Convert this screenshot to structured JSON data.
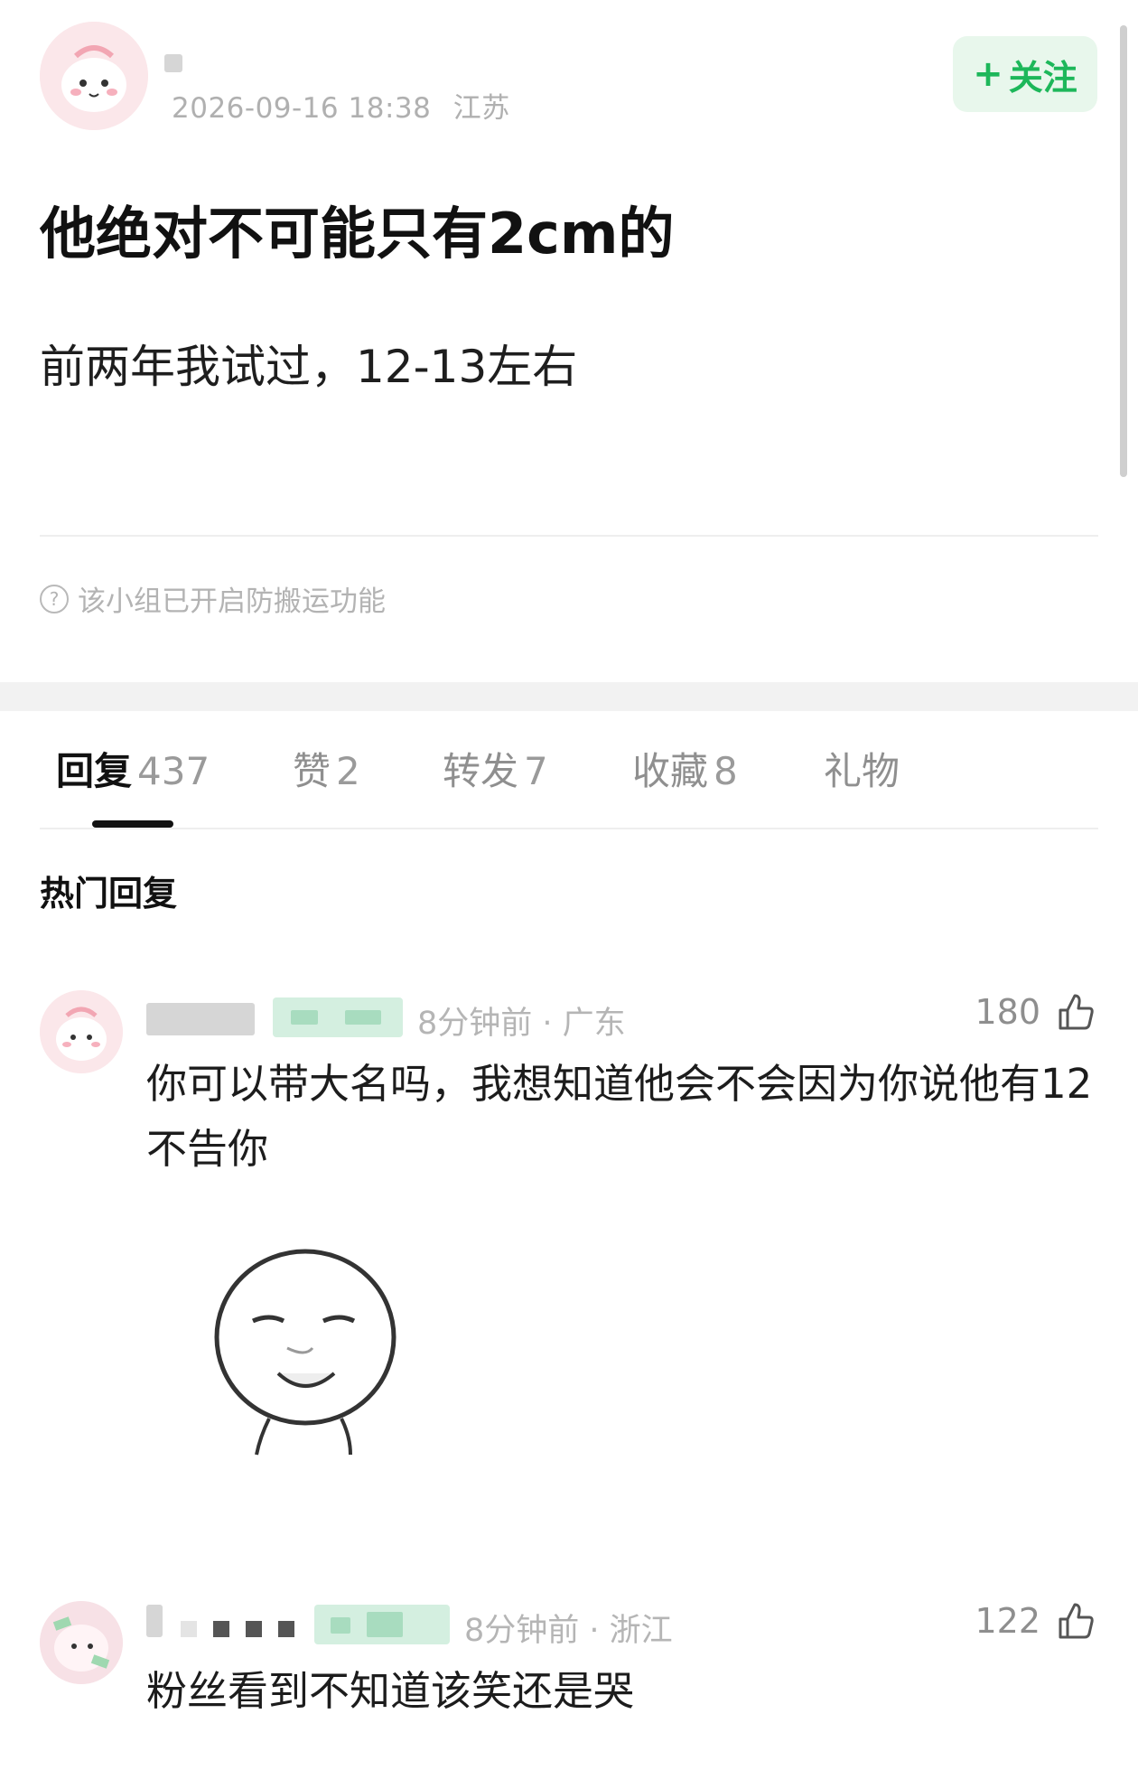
{
  "post": {
    "timestamp": "2026-09-16 18:38",
    "location": "江苏",
    "follow_label": "关注",
    "title": "他绝对不可能只有2cm的",
    "body": "前两年我试过，12-13左右",
    "notice": "该小组已开启防搬运功能"
  },
  "tabs": [
    {
      "label": "回复",
      "count": "437"
    },
    {
      "label": "赞",
      "count": "2"
    },
    {
      "label": "转发",
      "count": "7"
    },
    {
      "label": "收藏",
      "count": "8"
    },
    {
      "label": "礼物",
      "count": ""
    }
  ],
  "hot_replies_title": "热门回复",
  "comments": [
    {
      "time": "8分钟前",
      "location": "广东",
      "likes": "180",
      "text": "你可以带大名吗，我想知道他会不会因为你说他有12不告你",
      "has_sticker": true
    },
    {
      "time": "8分钟前",
      "location": "浙江",
      "likes": "122",
      "text": "粉丝看到不知道该笑还是哭",
      "has_sticker": false
    }
  ],
  "colors": {
    "accent_green": "#1db75a",
    "follow_bg": "#e8f7ec",
    "meta_gray": "#b0b0b0",
    "avatar_pink": "#fbe7ea"
  }
}
